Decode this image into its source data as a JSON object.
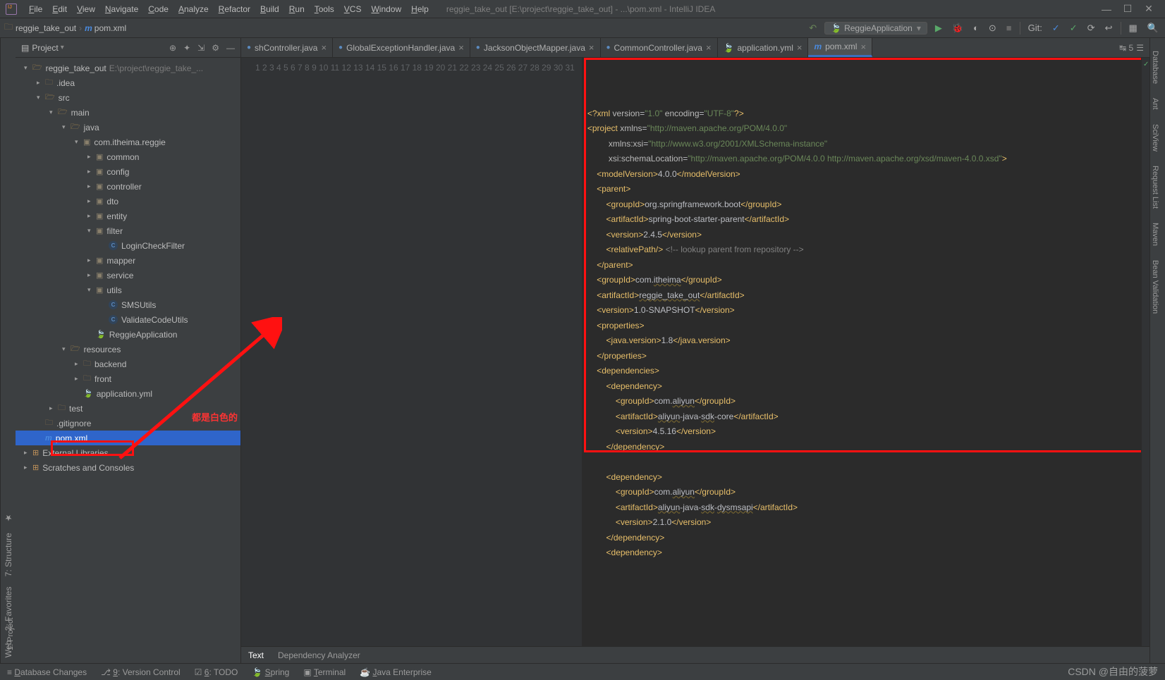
{
  "menu": [
    "File",
    "Edit",
    "View",
    "Navigate",
    "Code",
    "Analyze",
    "Refactor",
    "Build",
    "Run",
    "Tools",
    "VCS",
    "Window",
    "Help"
  ],
  "titlepath": "reggie_take_out [E:\\project\\reggie_take_out] - ...\\pom.xml - IntelliJ IDEA",
  "crumb_project": "reggie_take_out",
  "crumb_file": "pom.xml",
  "run_config": "ReggieApplication",
  "git_label": "Git:",
  "project_label": "Project",
  "left_rail": [
    "1: Project"
  ],
  "left_rail_bottom": [
    "Web",
    "2: Favorites",
    "7: Structure"
  ],
  "right_rail": [
    "Database",
    "Ant",
    "SciView",
    "Request List",
    "Maven",
    "Bean Validation"
  ],
  "tree": [
    {
      "depth": 0,
      "chev": "▾",
      "ico": "folder-open",
      "label": "reggie_take_out",
      "dim": "E:\\project\\reggie_take_..."
    },
    {
      "depth": 1,
      "chev": "▸",
      "ico": "folder",
      "label": ".idea"
    },
    {
      "depth": 1,
      "chev": "▾",
      "ico": "folder-open",
      "label": "src"
    },
    {
      "depth": 2,
      "chev": "▾",
      "ico": "folder-open",
      "label": "main"
    },
    {
      "depth": 3,
      "chev": "▾",
      "ico": "folder-open",
      "label": "java"
    },
    {
      "depth": 4,
      "chev": "▾",
      "ico": "pkg",
      "label": "com.itheima.reggie"
    },
    {
      "depth": 5,
      "chev": "▸",
      "ico": "pkg",
      "label": "common"
    },
    {
      "depth": 5,
      "chev": "▸",
      "ico": "pkg",
      "label": "config"
    },
    {
      "depth": 5,
      "chev": "▸",
      "ico": "pkg",
      "label": "controller"
    },
    {
      "depth": 5,
      "chev": "▸",
      "ico": "pkg",
      "label": "dto"
    },
    {
      "depth": 5,
      "chev": "▸",
      "ico": "pkg",
      "label": "entity"
    },
    {
      "depth": 5,
      "chev": "▾",
      "ico": "pkg",
      "label": "filter"
    },
    {
      "depth": 6,
      "chev": "",
      "ico": "java",
      "label": "LoginCheckFilter"
    },
    {
      "depth": 5,
      "chev": "▸",
      "ico": "pkg",
      "label": "mapper"
    },
    {
      "depth": 5,
      "chev": "▸",
      "ico": "pkg",
      "label": "service"
    },
    {
      "depth": 5,
      "chev": "▾",
      "ico": "pkg",
      "label": "utils"
    },
    {
      "depth": 6,
      "chev": "",
      "ico": "java",
      "label": "SMSUtils"
    },
    {
      "depth": 6,
      "chev": "",
      "ico": "java",
      "label": "ValidateCodeUtils"
    },
    {
      "depth": 5,
      "chev": "",
      "ico": "leaf",
      "label": "ReggieApplication"
    },
    {
      "depth": 3,
      "chev": "▾",
      "ico": "folder-open",
      "label": "resources"
    },
    {
      "depth": 4,
      "chev": "▸",
      "ico": "folder",
      "label": "backend"
    },
    {
      "depth": 4,
      "chev": "▸",
      "ico": "folder",
      "label": "front"
    },
    {
      "depth": 4,
      "chev": "",
      "ico": "leaf",
      "label": "application.yml"
    },
    {
      "depth": 2,
      "chev": "▸",
      "ico": "folder",
      "label": "test"
    },
    {
      "depth": 1,
      "chev": "",
      "ico": "folder",
      "label": ".gitignore",
      "dot": true
    },
    {
      "depth": 1,
      "chev": "",
      "ico": "m",
      "label": "pom.xml",
      "selected": true
    },
    {
      "depth": 0,
      "chev": "▸",
      "ico": "lib",
      "label": "External Libraries"
    },
    {
      "depth": 0,
      "chev": "▸",
      "ico": "lib",
      "label": "Scratches and Consoles"
    }
  ],
  "tabs": [
    {
      "icon": "jicon",
      "label": "shController.java"
    },
    {
      "icon": "jicon",
      "label": "GlobalExceptionHandler.java"
    },
    {
      "icon": "jicon",
      "label": "JacksonObjectMapper.java"
    },
    {
      "icon": "jicon",
      "label": "CommonController.java"
    },
    {
      "icon": "yicon",
      "label": "application.yml"
    },
    {
      "icon": "micon",
      "label": "pom.xml",
      "active": true
    }
  ],
  "tabs_overflow": "↹ 5",
  "gutter_start": 1,
  "gutter_end": 31,
  "code_lines": [
    [
      {
        "t": "tag",
        "v": "<?xml "
      },
      {
        "t": "attr",
        "v": "version"
      },
      {
        "t": "txt",
        "v": "="
      },
      {
        "t": "val",
        "v": "\"1.0\""
      },
      {
        "t": "txt",
        "v": " "
      },
      {
        "t": "attr",
        "v": "encoding"
      },
      {
        "t": "txt",
        "v": "="
      },
      {
        "t": "val",
        "v": "\"UTF-8\""
      },
      {
        "t": "tag",
        "v": "?>"
      }
    ],
    [
      {
        "t": "tag",
        "v": "<project "
      },
      {
        "t": "attr",
        "v": "xmlns"
      },
      {
        "t": "txt",
        "v": "="
      },
      {
        "t": "val",
        "v": "\"http://maven.apache.org/POM/4.0.0\""
      }
    ],
    [
      {
        "t": "txt",
        "v": "         "
      },
      {
        "t": "attr",
        "v": "xmlns:xsi"
      },
      {
        "t": "txt",
        "v": "="
      },
      {
        "t": "val",
        "v": "\"http://www.w3.org/2001/XMLSchema-instance\""
      }
    ],
    [
      {
        "t": "txt",
        "v": "         "
      },
      {
        "t": "attr",
        "v": "xsi:schemaLocation"
      },
      {
        "t": "txt",
        "v": "="
      },
      {
        "t": "val",
        "v": "\"http://maven.apache.org/POM/4.0.0 http://maven.apache.org/xsd/maven-4.0.0.xsd\""
      },
      {
        "t": "tag",
        "v": ">"
      }
    ],
    [
      {
        "t": "txt",
        "v": "    "
      },
      {
        "t": "tag",
        "v": "<modelVersion>"
      },
      {
        "t": "txt",
        "v": "4.0.0"
      },
      {
        "t": "tag",
        "v": "</modelVersion>"
      }
    ],
    [
      {
        "t": "txt",
        "v": "    "
      },
      {
        "t": "tag",
        "v": "<parent>"
      }
    ],
    [
      {
        "t": "txt",
        "v": "        "
      },
      {
        "t": "tag",
        "v": "<groupId>"
      },
      {
        "t": "txt",
        "v": "org.springframework.boot"
      },
      {
        "t": "tag",
        "v": "</groupId>"
      }
    ],
    [
      {
        "t": "txt",
        "v": "        "
      },
      {
        "t": "tag",
        "v": "<artifactId>"
      },
      {
        "t": "txt",
        "v": "spring-boot-starter-parent"
      },
      {
        "t": "tag",
        "v": "</artifactId>"
      }
    ],
    [
      {
        "t": "txt",
        "v": "        "
      },
      {
        "t": "tag",
        "v": "<version>"
      },
      {
        "t": "txt",
        "v": "2.4.5"
      },
      {
        "t": "tag",
        "v": "</version>"
      }
    ],
    [
      {
        "t": "txt",
        "v": "        "
      },
      {
        "t": "tag",
        "v": "<relativePath/>"
      },
      {
        "t": "txt",
        "v": " "
      },
      {
        "t": "cmt",
        "v": "<!-- lookup parent from repository -->"
      }
    ],
    [
      {
        "t": "txt",
        "v": "    "
      },
      {
        "t": "tag",
        "v": "</parent>"
      }
    ],
    [
      {
        "t": "txt",
        "v": "    "
      },
      {
        "t": "tag",
        "v": "<groupId>"
      },
      {
        "t": "txt",
        "v": "com."
      },
      {
        "t": "wavy",
        "v": "itheima"
      },
      {
        "t": "tag",
        "v": "</groupId>"
      }
    ],
    [
      {
        "t": "txt",
        "v": "    "
      },
      {
        "t": "tag",
        "v": "<artifactId>"
      },
      {
        "t": "wavy",
        "v": "reggie_take_out"
      },
      {
        "t": "tag",
        "v": "</artifactId>"
      }
    ],
    [
      {
        "t": "txt",
        "v": "    "
      },
      {
        "t": "tag",
        "v": "<version>"
      },
      {
        "t": "txt",
        "v": "1.0-SNAPSHOT"
      },
      {
        "t": "tag",
        "v": "</version>"
      }
    ],
    [
      {
        "t": "txt",
        "v": "    "
      },
      {
        "t": "tag",
        "v": "<properties>"
      }
    ],
    [
      {
        "t": "txt",
        "v": "        "
      },
      {
        "t": "tag",
        "v": "<java.version>"
      },
      {
        "t": "txt",
        "v": "1.8"
      },
      {
        "t": "tag",
        "v": "</java.version>"
      }
    ],
    [
      {
        "t": "txt",
        "v": "    "
      },
      {
        "t": "tag",
        "v": "</properties>"
      }
    ],
    [
      {
        "t": "txt",
        "v": "    "
      },
      {
        "t": "tag",
        "v": "<dependencies>"
      }
    ],
    [
      {
        "t": "txt",
        "v": "        "
      },
      {
        "t": "tag",
        "v": "<dependency>"
      }
    ],
    [
      {
        "t": "txt",
        "v": "            "
      },
      {
        "t": "tag",
        "v": "<groupId>"
      },
      {
        "t": "txt",
        "v": "com."
      },
      {
        "t": "wavy",
        "v": "aliyun"
      },
      {
        "t": "tag",
        "v": "</groupId>"
      }
    ],
    [
      {
        "t": "txt",
        "v": "            "
      },
      {
        "t": "tag",
        "v": "<artifactId>"
      },
      {
        "t": "wavy",
        "v": "aliyun"
      },
      {
        "t": "txt",
        "v": "-java-"
      },
      {
        "t": "wavy",
        "v": "sdk"
      },
      {
        "t": "txt",
        "v": "-core"
      },
      {
        "t": "tag",
        "v": "</artifactId>"
      }
    ],
    [
      {
        "t": "txt",
        "v": "            "
      },
      {
        "t": "tag",
        "v": "<version>"
      },
      {
        "t": "txt",
        "v": "4.5.16"
      },
      {
        "t": "tag",
        "v": "</version>"
      }
    ],
    [
      {
        "t": "txt",
        "v": "        "
      },
      {
        "t": "tag",
        "v": "</dependency>"
      }
    ],
    [
      {
        "t": "txt",
        "v": ""
      }
    ],
    [
      {
        "t": "txt",
        "v": "        "
      },
      {
        "t": "tag",
        "v": "<dependency>"
      }
    ],
    [
      {
        "t": "txt",
        "v": "            "
      },
      {
        "t": "tag",
        "v": "<groupId>"
      },
      {
        "t": "txt",
        "v": "com."
      },
      {
        "t": "wavy",
        "v": "aliyun"
      },
      {
        "t": "tag",
        "v": "</groupId>"
      }
    ],
    [
      {
        "t": "txt",
        "v": "            "
      },
      {
        "t": "tag",
        "v": "<artifactId>"
      },
      {
        "t": "wavy",
        "v": "aliyun"
      },
      {
        "t": "txt",
        "v": "-java-"
      },
      {
        "t": "wavy",
        "v": "sdk"
      },
      {
        "t": "txt",
        "v": "-"
      },
      {
        "t": "wavy",
        "v": "dysmsapi"
      },
      {
        "t": "tag",
        "v": "</artifactId>"
      }
    ],
    [
      {
        "t": "txt",
        "v": "            "
      },
      {
        "t": "tag",
        "v": "<version>"
      },
      {
        "t": "txt",
        "v": "2.1.0"
      },
      {
        "t": "tag",
        "v": "</version>"
      }
    ],
    [
      {
        "t": "txt",
        "v": "        "
      },
      {
        "t": "tag",
        "v": "</dependency>"
      }
    ],
    [
      {
        "t": "txt",
        "v": "        "
      },
      {
        "t": "tag",
        "v": "<dependency>"
      }
    ],
    [
      {
        "t": "txt",
        "v": ""
      }
    ]
  ],
  "sub_tabs": [
    "Text",
    "Dependency Analyzer"
  ],
  "statusbar": [
    "Database Changes",
    "9: Version Control",
    "6: TODO",
    "Spring",
    "Terminal",
    "Java Enterprise"
  ],
  "annotation": "都是白色的",
  "watermark": "CSDN @自由的菠萝"
}
